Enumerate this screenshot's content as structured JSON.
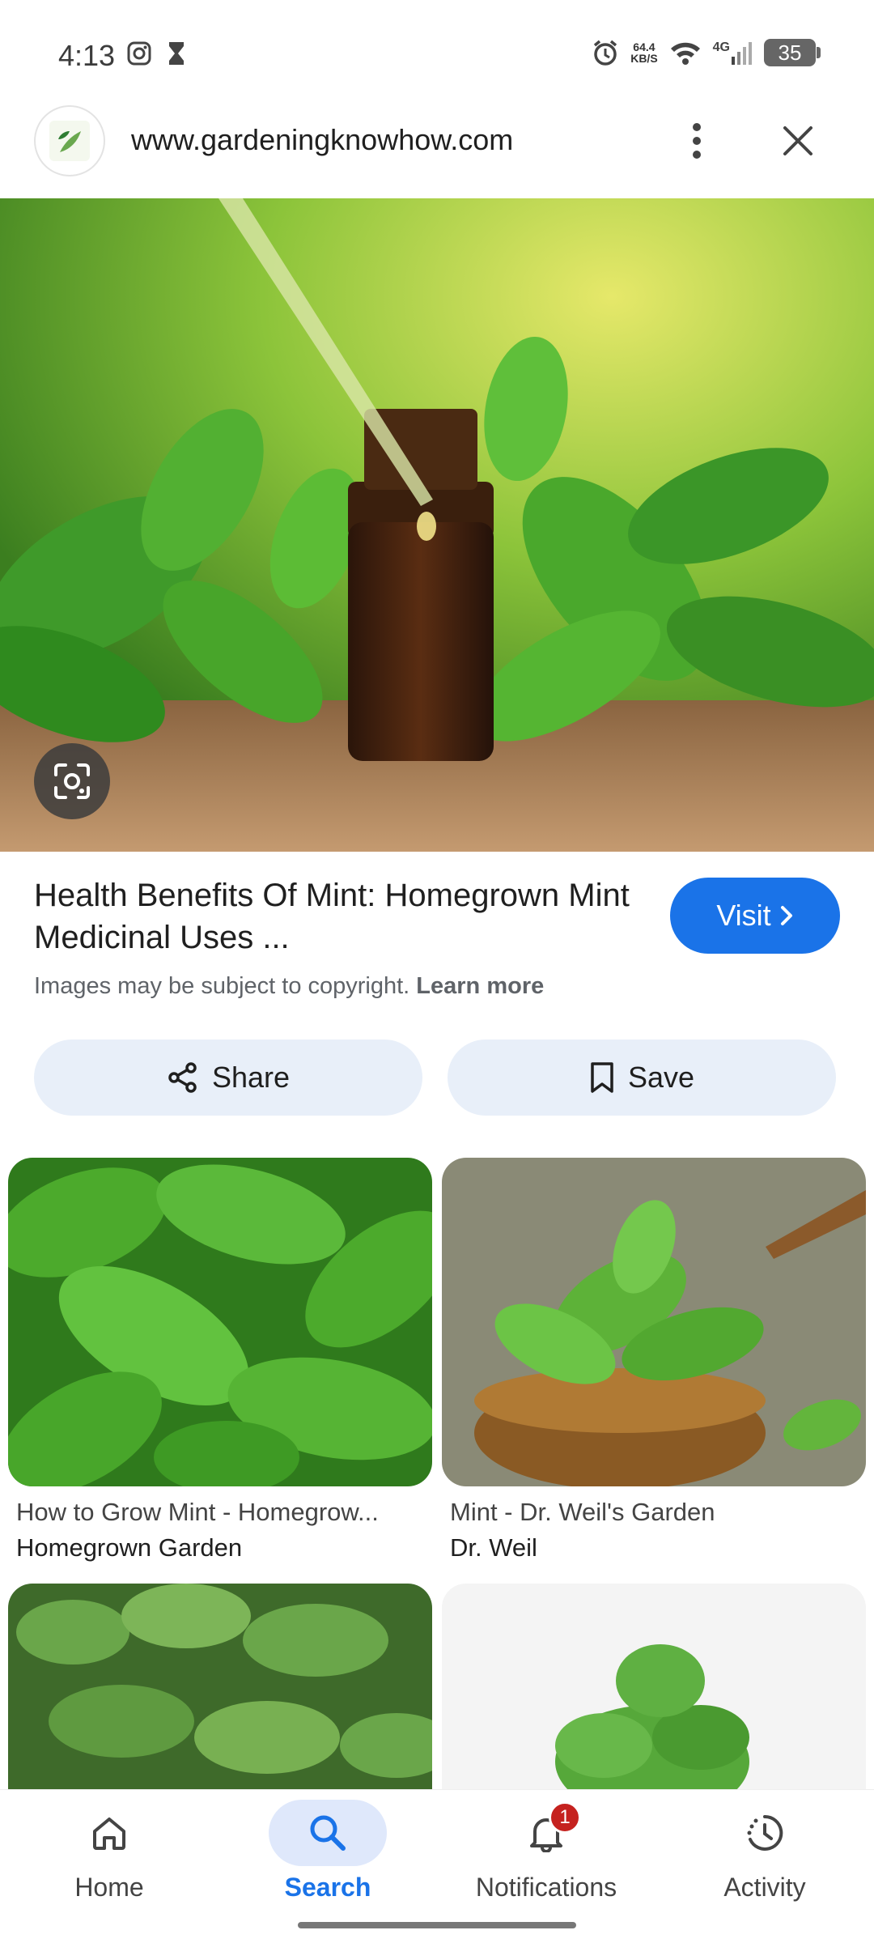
{
  "status_bar": {
    "time": "4:13",
    "net_speed_value": "64.4",
    "net_speed_unit": "KB/S",
    "network": "4G",
    "battery": "35"
  },
  "header": {
    "site_url": "www.gardeningknowhow.com"
  },
  "result": {
    "title": "Health Benefits Of Mint: Homegrown Mint Medicinal Uses ...",
    "visit_label": "Visit",
    "copyright_text": "Images may be subject to copyright.",
    "learn_more": "Learn more",
    "share_label": "Share",
    "save_label": "Save"
  },
  "related": [
    {
      "title": "How to Grow Mint - Homegrow...",
      "source": "Homegrown Garden"
    },
    {
      "title": "Mint - Dr. Weil's Garden",
      "source": "Dr. Weil"
    }
  ],
  "bottom_nav": {
    "items": [
      {
        "label": "Home",
        "icon": "home-icon"
      },
      {
        "label": "Search",
        "icon": "search-icon",
        "active": true
      },
      {
        "label": "Notifications",
        "icon": "bell-icon",
        "badge": "1"
      },
      {
        "label": "Activity",
        "icon": "activity-icon"
      }
    ]
  },
  "colors": {
    "accent": "#1a73e8",
    "chip_bg": "#e8eff9",
    "badge": "#c5221f"
  }
}
